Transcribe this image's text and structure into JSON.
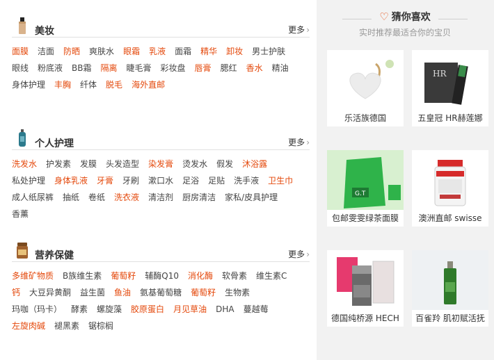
{
  "sections": [
    {
      "title": "美妆",
      "more": "更多",
      "tags": [
        {
          "label": "面膜",
          "hot": true
        },
        {
          "label": "洁面",
          "hot": false
        },
        {
          "label": "防晒",
          "hot": true
        },
        {
          "label": "爽肤水",
          "hot": false
        },
        {
          "label": "眼霜",
          "hot": true
        },
        {
          "label": "乳液",
          "hot": true
        },
        {
          "label": "面霜",
          "hot": false
        },
        {
          "label": "精华",
          "hot": true
        },
        {
          "label": "卸妆",
          "hot": true
        },
        {
          "label": "男士护肤",
          "hot": false
        },
        {
          "label": "眼线",
          "hot": false
        },
        {
          "label": "粉底液",
          "hot": false
        },
        {
          "label": "BB霜",
          "hot": false
        },
        {
          "label": "隔离",
          "hot": true
        },
        {
          "label": "睫毛膏",
          "hot": false
        },
        {
          "label": "彩妆盘",
          "hot": false
        },
        {
          "label": "唇膏",
          "hot": true
        },
        {
          "label": "腮红",
          "hot": false
        },
        {
          "label": "香水",
          "hot": true
        },
        {
          "label": "精油",
          "hot": false
        },
        {
          "label": "身体护理",
          "hot": false
        },
        {
          "label": "丰胸",
          "hot": true
        },
        {
          "label": "纤体",
          "hot": false
        },
        {
          "label": "脱毛",
          "hot": true
        },
        {
          "label": "海外直邮",
          "hot": true
        }
      ]
    },
    {
      "title": "个人护理",
      "more": "更多",
      "tags": [
        {
          "label": "洗发水",
          "hot": true
        },
        {
          "label": "护发素",
          "hot": false
        },
        {
          "label": "发膜",
          "hot": false
        },
        {
          "label": "头发造型",
          "hot": false
        },
        {
          "label": "染发膏",
          "hot": true
        },
        {
          "label": "烫发水",
          "hot": false
        },
        {
          "label": "假发",
          "hot": false
        },
        {
          "label": "沐浴露",
          "hot": true
        },
        {
          "label": "私处护理",
          "hot": false
        },
        {
          "label": "身体乳液",
          "hot": true
        },
        {
          "label": "牙膏",
          "hot": true
        },
        {
          "label": "牙刷",
          "hot": false
        },
        {
          "label": "漱口水",
          "hot": false
        },
        {
          "label": "足浴",
          "hot": false
        },
        {
          "label": "足贴",
          "hot": false
        },
        {
          "label": "洗手液",
          "hot": false
        },
        {
          "label": "卫生巾",
          "hot": true
        },
        {
          "label": "成人纸尿裤",
          "hot": false
        },
        {
          "label": "抽纸",
          "hot": false
        },
        {
          "label": "卷纸",
          "hot": false
        },
        {
          "label": "洗衣液",
          "hot": true
        },
        {
          "label": "清洁剂",
          "hot": false
        },
        {
          "label": "厨房清洁",
          "hot": false
        },
        {
          "label": "家私/皮具护理",
          "hot": false
        },
        {
          "label": "香薰",
          "hot": false
        }
      ]
    },
    {
      "title": "营养保健",
      "more": "更多",
      "tags": [
        {
          "label": "多维矿物质",
          "hot": true
        },
        {
          "label": "B族维生素",
          "hot": false
        },
        {
          "label": "葡萄籽",
          "hot": true
        },
        {
          "label": "辅酶Q10",
          "hot": false
        },
        {
          "label": "消化酶",
          "hot": true
        },
        {
          "label": "软骨素",
          "hot": false
        },
        {
          "label": "维生素C",
          "hot": false
        },
        {
          "label": "钙",
          "hot": true
        },
        {
          "label": "大豆异黄酮",
          "hot": false
        },
        {
          "label": "益生菌",
          "hot": false
        },
        {
          "label": "鱼油",
          "hot": true
        },
        {
          "label": "氨基葡萄糖",
          "hot": false
        },
        {
          "label": "葡萄籽",
          "hot": true
        },
        {
          "label": "生物素",
          "hot": false
        },
        {
          "label": "玛咖（玛卡）",
          "hot": false
        },
        {
          "label": "酵素",
          "hot": false
        },
        {
          "label": "螺旋藻",
          "hot": false
        },
        {
          "label": "胶原蛋白",
          "hot": true
        },
        {
          "label": "月见草油",
          "hot": true
        },
        {
          "label": "DHA",
          "hot": false
        },
        {
          "label": "蔓越莓",
          "hot": false
        },
        {
          "label": "左旋肉碱",
          "hot": true
        },
        {
          "label": "褪黑素",
          "hot": false
        },
        {
          "label": "锯棕榈",
          "hot": false
        }
      ]
    }
  ],
  "guess": {
    "title": "猜你喜欢",
    "subtitle": "实时推荐最适合你的宝贝",
    "items": [
      {
        "caption": "乐活族德国",
        "image": "heart-sponge-product"
      },
      {
        "caption": "五皇冠 HR赫莲娜",
        "image": "hr-sample-sachet-product"
      },
      {
        "caption": "包邮雯雯绿茶面膜",
        "image": "green-tea-mask-product"
      },
      {
        "caption": "澳洲直邮 swisse",
        "image": "swisse-bottle-product"
      },
      {
        "caption": "德国纯桥源 HECH",
        "image": "caviar-box-product"
      },
      {
        "caption": "百雀羚 肌初赋活抚",
        "image": "green-serum-bottle-product"
      }
    ]
  },
  "colors": {
    "hot": "#e4480b",
    "normal": "#444444",
    "sidebar_bg": "#f2f2f2"
  }
}
